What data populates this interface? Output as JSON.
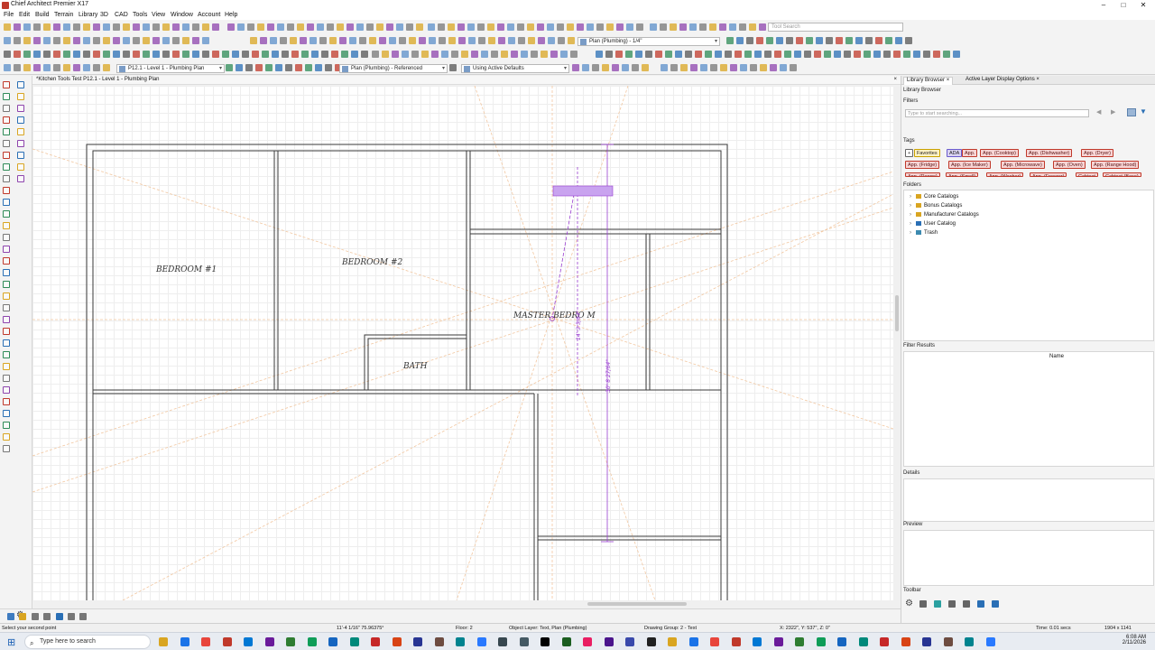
{
  "app": {
    "title": "Chief Architect Premier X17",
    "window_controls": [
      "–",
      "□",
      "✕"
    ]
  },
  "menu": [
    "File",
    "Edit",
    "Build",
    "Terrain",
    "Library",
    "3D",
    "CAD",
    "Tools",
    "View",
    "Window",
    "Account",
    "Help"
  ],
  "toolbar": {
    "search_placeholder": "Tool Search",
    "view_dropdown": "Plan (Plumbing) - 1/4\"",
    "layer_set": "P12.1 - Level 1 - Plumbing Plan",
    "plan_view": "Plan (Plumbing) - Referenced",
    "defaults": "Using Active Defaults"
  },
  "document_tab": {
    "title": "*Kitchen Tools Test P12.1 - Level 1 - Plumbing Plan",
    "close": "×"
  },
  "plan": {
    "rooms": [
      {
        "key": "bed1",
        "label": "BEDROOM #1"
      },
      {
        "key": "bed2",
        "label": "BEDROOM #2"
      },
      {
        "key": "master",
        "label": "MASTER BEDRO  M"
      },
      {
        "key": "bath",
        "label": "BATH"
      }
    ],
    "dimensions": [
      "14' 3 5/64\"",
      "30' 8 27/64\""
    ],
    "colors": {
      "wall": "#3a3a3a",
      "snap_line": "#f2c7a0",
      "dimension": "#9a3fd0",
      "selection": "#c9a3ef"
    }
  },
  "right_panel": {
    "tabs": [
      {
        "label": "Library Browser",
        "close": "×"
      },
      {
        "label": "Active Layer Display Options",
        "close": "×"
      }
    ],
    "library_browser_title": "Library Browser",
    "filters_label": "Filters",
    "search_placeholder": "Type to start searching...",
    "tags_label": "Tags",
    "tags_row1": [
      "Favorites",
      "ADA",
      "App.",
      "App. (Cooktop)",
      "App. (Dishwasher)",
      "App. (Dryer)"
    ],
    "tags_row2": [
      "App. (Fridge)",
      "App. (Ice Maker)",
      "App. (Microwave)",
      "App. (Oven)",
      "App. (Range Hood)"
    ],
    "tags_row3": [
      "App. (Range)",
      "App. (Small)",
      "App. (Washer)",
      "App. (Freezer)",
      "Cabinet",
      "Cabinet (Base)"
    ],
    "folders_label": "Folders",
    "folders": [
      {
        "name": "Core Catalogs",
        "color": "#d9a521"
      },
      {
        "name": "Bonus Catalogs",
        "color": "#d9a521"
      },
      {
        "name": "Manufacturer Catalogs",
        "color": "#d9a521"
      },
      {
        "name": "User Catalog",
        "color": "#2a6fb5"
      },
      {
        "name": "Trash",
        "color": "#3c8ab0"
      }
    ],
    "filter_results_label": "Filter Results",
    "name_column": "Name",
    "details_label": "Details",
    "preview_label": "Preview",
    "toolbar_label": "Toolbar"
  },
  "status": {
    "prompt": "Select your second point",
    "measure": "11'-4 1/16\" 75.96375°",
    "floor": "Floor: 2",
    "object_layer": "Object Layer: Text, Plan (Plumbing)",
    "drawing_group": "Drawing Group: 2 - Text",
    "coords": "X: 2322\", Y: 537\", Z: 0\"",
    "time": "Time: 0.01 secs",
    "resolution": "1904 x 1141"
  },
  "taskbar": {
    "search_text": "Type here to search",
    "time": "6:08 AM",
    "date": "2/11/2026"
  }
}
